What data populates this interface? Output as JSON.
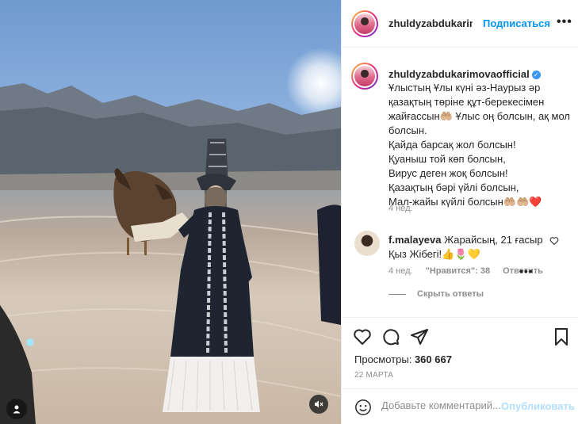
{
  "post": {
    "username_header": "zhuldyzabdukarimova",
    "follow_label": "Подписаться",
    "more_label": "•••",
    "caption_user": "zhuldyzabdukarimovaofficial",
    "caption_text": "Ұлыстың Ұлы күні әз-Наурыз әр қазақтың төріне құт-берекесімен жайғассын🤲🏼 Ұлыс оң болсын, ақ мол болсын.\nҚайда барсақ жол болсын!\nҚуаныш той көп болсын,\nВирус деген жоқ болсын!\nҚазақтың бәрі үйлі болсын,\nМал-жайы күйлі болсын🤲🏼🤲🏼❤️",
    "caption_time": "4 нед.",
    "views_label": "Просмотры:",
    "views_count": "360 667",
    "date": "22 МАРТА"
  },
  "comment": {
    "username": "f.malayeva",
    "text": "Жарайсың, 21 ғасыр Қыз Жібегі!👍🌷💛",
    "time": "4 нед.",
    "likes": "\"Нравится\": 38",
    "reply": "Ответить",
    "hide_replies": "Скрыть ответы"
  },
  "add_comment": {
    "placeholder": "Добавьте комментарий...",
    "publish_label": "Опубликовать"
  },
  "colors": {
    "accent": "#0095f6",
    "verified": "#3897f0",
    "heart": "#ed4956"
  }
}
